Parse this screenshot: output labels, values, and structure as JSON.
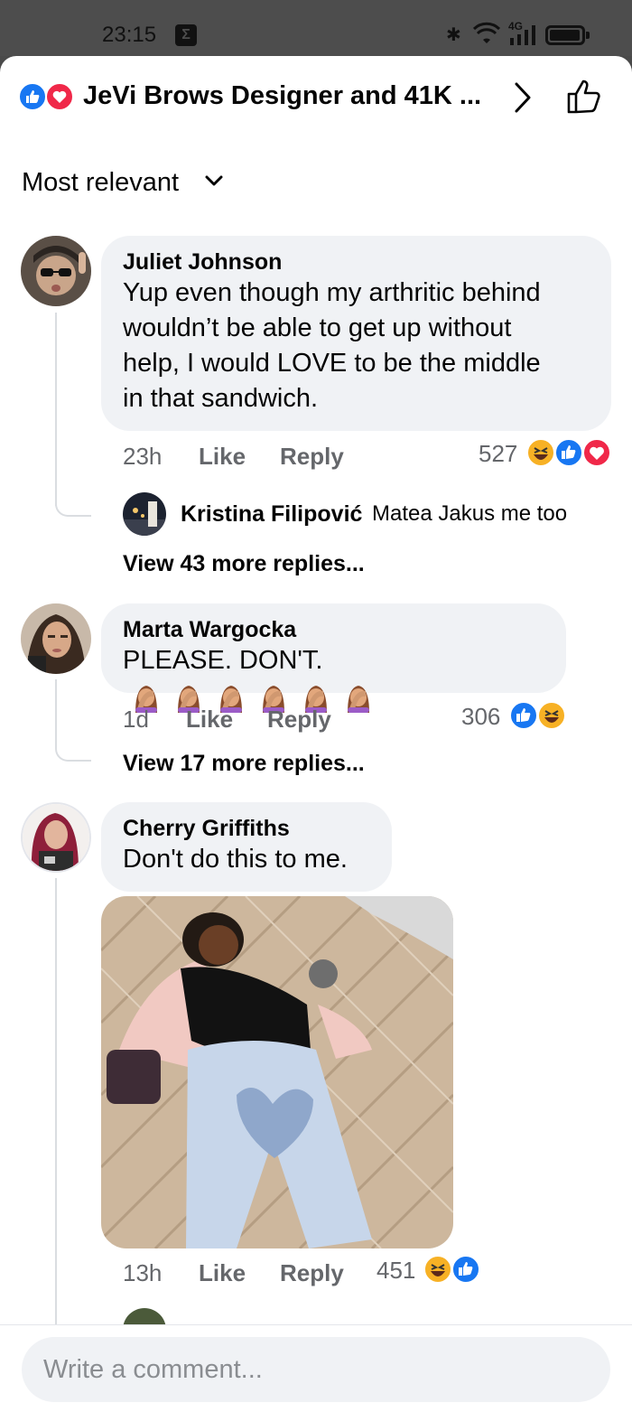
{
  "status_bar": {
    "time": "23:15",
    "notif_glyph": "Σ",
    "network": "4G"
  },
  "header": {
    "title": "JeVi Brows Designer and 41K ...",
    "icons": [
      "like-reaction-icon",
      "love-reaction-icon",
      "chevron-right-icon",
      "thumbs-up-icon"
    ]
  },
  "sort": {
    "label": "Most relevant"
  },
  "comments": [
    {
      "name": "Juliet Johnson",
      "text_lines": [
        "Yup even though my arthritic behind",
        "wouldn’t be able to get up without",
        "help, I would LOVE to be the middle",
        "in that sandwich."
      ],
      "time": "23h",
      "like_label": "Like",
      "reply_label": "Reply",
      "reaction_count": "527",
      "reactions": [
        "haha",
        "like",
        "love"
      ],
      "reply_preview": {
        "name": "Kristina Filipović",
        "text": "Matea Jakus me too"
      },
      "view_more": "View 43 more replies..."
    },
    {
      "name": "Marta Wargocka",
      "text": "PLEASE. DON'T.",
      "emoji": [
        "facepalm",
        "facepalm",
        "facepalm",
        "facepalm",
        "facepalm",
        "facepalm"
      ],
      "time": "1d",
      "like_label": "Like",
      "reply_label": "Reply",
      "reaction_count": "306",
      "reactions": [
        "like",
        "haha"
      ],
      "view_more": "View 17 more replies..."
    },
    {
      "name": "Cherry Griffiths",
      "text": "Don't do this to me.",
      "time": "13h",
      "like_label": "Like",
      "reply_label": "Reply",
      "reaction_count": "451",
      "reactions": [
        "haha",
        "like"
      ]
    }
  ],
  "composer": {
    "placeholder": "Write a comment..."
  },
  "colors": {
    "accent": "#1877f2",
    "love": "#f02849",
    "haha": "#f7b125",
    "bubble": "#f0f2f5",
    "muted": "#65676b"
  }
}
